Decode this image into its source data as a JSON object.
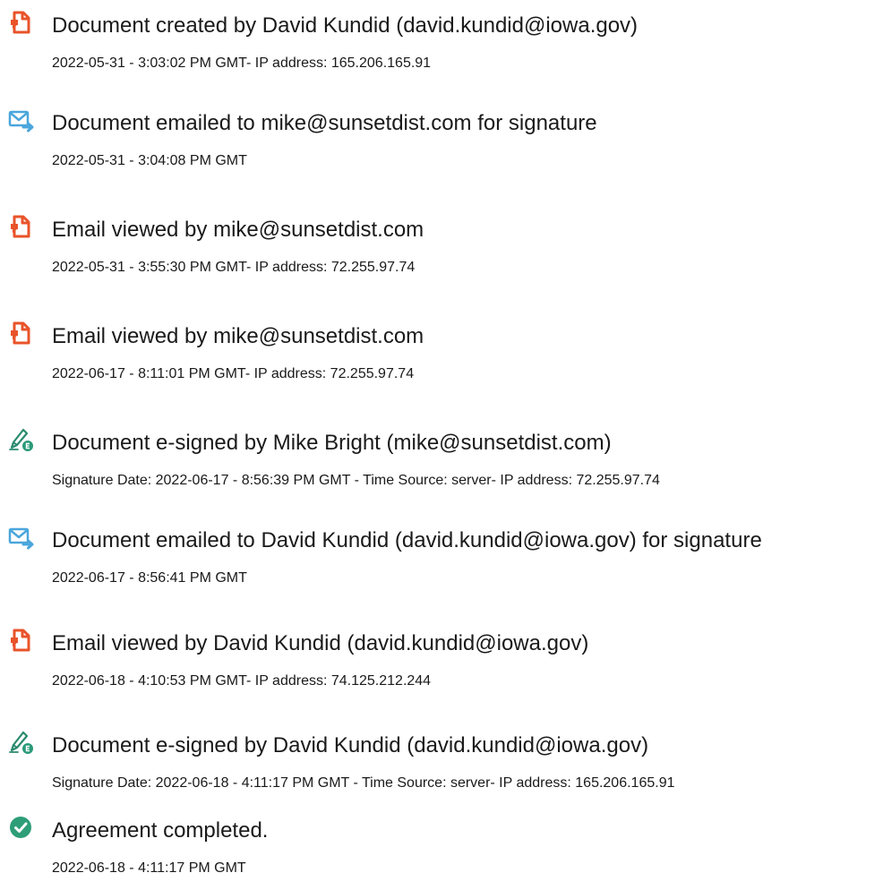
{
  "colors": {
    "document_icon": "#e8532a",
    "email_icon": "#4aa6dc",
    "esign_icon_pen": "#2a8a6e",
    "esign_icon_badge": "#2a9a7a",
    "complete_icon": "#2d9e78",
    "text": "#1a1a1a"
  },
  "events": [
    {
      "icon": "document-icon",
      "title": "Document created by David Kundid (david.kundid@iowa.gov)",
      "detail": "2022-05-31 - 3:03:02 PM GMT- IP address: 165.206.165.91"
    },
    {
      "icon": "email-send-icon",
      "title": "Document emailed to mike@sunsetdist.com for signature",
      "detail": "2022-05-31 - 3:04:08 PM GMT"
    },
    {
      "icon": "document-icon",
      "title": "Email viewed by mike@sunsetdist.com",
      "detail": "2022-05-31 - 3:55:30 PM GMT- IP address: 72.255.97.74"
    },
    {
      "icon": "document-icon",
      "title": "Email viewed by mike@sunsetdist.com",
      "detail": "2022-06-17 - 8:11:01 PM GMT- IP address: 72.255.97.74"
    },
    {
      "icon": "esign-pen-icon",
      "title": "Document e-signed by Mike Bright (mike@sunsetdist.com)",
      "detail": "Signature Date: 2022-06-17 - 8:56:39 PM GMT - Time Source: server- IP address: 72.255.97.74"
    },
    {
      "icon": "email-send-icon",
      "title": "Document emailed to David Kundid (david.kundid@iowa.gov) for signature",
      "detail": "2022-06-17 - 8:56:41 PM GMT"
    },
    {
      "icon": "document-icon",
      "title": "Email viewed by David Kundid (david.kundid@iowa.gov)",
      "detail": "2022-06-18 - 4:10:53 PM GMT- IP address: 74.125.212.244"
    },
    {
      "icon": "esign-pen-icon",
      "title": "Document e-signed by David Kundid (david.kundid@iowa.gov)",
      "detail": "Signature Date: 2022-06-18 - 4:11:17 PM GMT - Time Source: server- IP address: 165.206.165.91"
    },
    {
      "icon": "checkmark-circle-icon",
      "title": "Agreement completed.",
      "detail": "2022-06-18 - 4:11:17 PM GMT"
    }
  ]
}
